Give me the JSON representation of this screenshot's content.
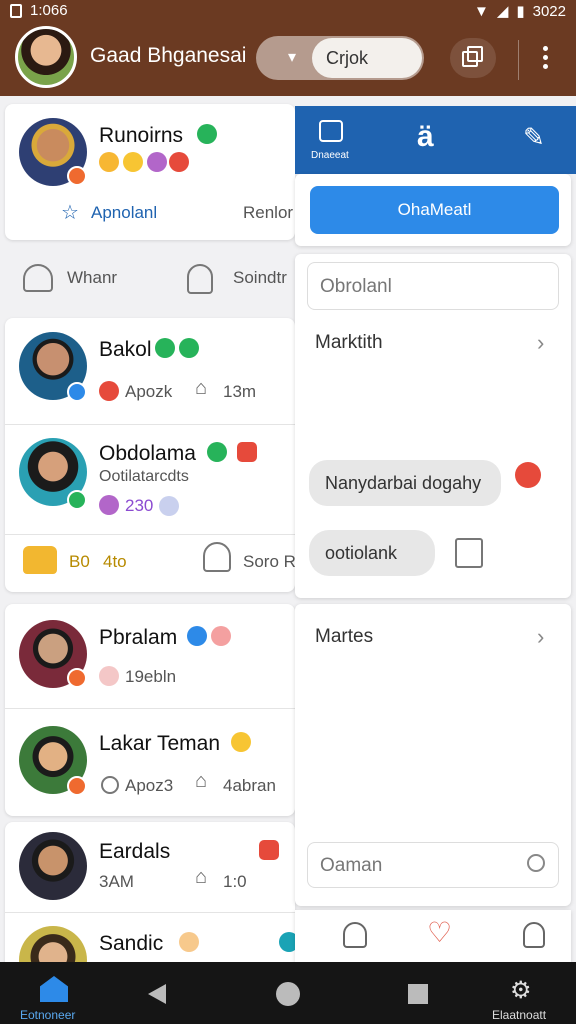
{
  "status_bar": {
    "time": "1:066",
    "battery": "3022"
  },
  "app_bar": {
    "title": "Gaad Bhganesai",
    "toggle_label": "Crjok"
  },
  "feed": {
    "first_card": {
      "name": "Runoirns",
      "action_primary": "Apnolanl",
      "action_secondary": "Renlor"
    },
    "tab_row": {
      "tab_1": "Whanr",
      "tab_2": "Soindtr"
    },
    "card_two": {
      "person_1": {
        "name": "Bakol",
        "meta_1": "Apozk",
        "meta_2": "13m"
      },
      "person_2": {
        "name": "Obdolama",
        "subtitle": "Ootilatarcdts",
        "count": "230"
      },
      "actions": {
        "left": "B0",
        "left_value": "4to",
        "right": "Soro R"
      }
    },
    "card_three": {
      "person_1": {
        "name": "Pbralam",
        "meta": "19ebln"
      },
      "person_2": {
        "name": "Lakar Teman",
        "meta_1": "Apoz3",
        "meta_2": "4abran"
      }
    },
    "card_four": {
      "person_1": {
        "name": "Eardals",
        "meta_1": "3AM",
        "meta_2": "1:0"
      },
      "person_2": {
        "name": "Sandic"
      }
    }
  },
  "side_panel": {
    "header": {
      "left_label": "Dnaeeat",
      "center_icon": "translate-icon"
    },
    "blue_button": "OhaMeatl",
    "input_placeholder": "Obrolanl",
    "list_item_1": "Marktith",
    "chat_bubble": "Nanydarbai dogahy",
    "chip": "ootiolank",
    "list_item_2": "Martes",
    "search_placeholder": "Oaman"
  },
  "bottom_nav": {
    "home_label": "Eotnoneer",
    "settings_label": "Elaatnoatt"
  },
  "colors": {
    "brand": "#6b3a22",
    "accent": "#1f63b0",
    "button": "#2d8ae8"
  }
}
